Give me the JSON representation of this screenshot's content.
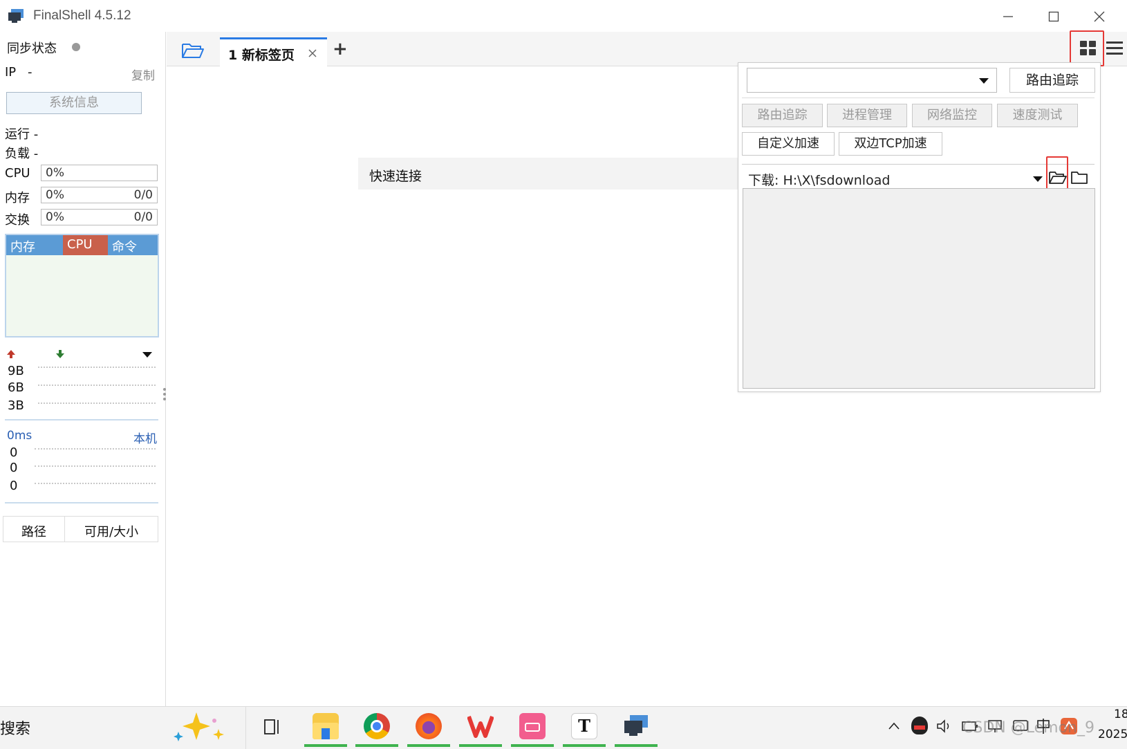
{
  "window": {
    "title": "FinalShell 4.5.12"
  },
  "sidebar": {
    "sync_label": "同步状态",
    "ip_label": "IP",
    "ip_value": "-",
    "copy_label": "复制",
    "sysinfo_button": "系统信息",
    "run_label": "运行 -",
    "load_label": "负载 -",
    "cpu": {
      "label": "CPU",
      "value": "0%"
    },
    "mem": {
      "label": "内存",
      "value": "0%",
      "ratio": "0/0"
    },
    "swap": {
      "label": "交换",
      "value": "0%",
      "ratio": "0/0"
    },
    "tabs": [
      "内存",
      "CPU",
      "命令"
    ],
    "net_ticks": [
      "9B",
      "6B",
      "3B"
    ],
    "ping_label": "0ms",
    "ping_host": "本机",
    "ping_ticks": [
      "0",
      "0",
      "0"
    ],
    "disk_headers": [
      "路径",
      "可用/大小"
    ]
  },
  "tabbar": {
    "tab_label": "1 新标签页",
    "add": "+"
  },
  "quick_connect": "快速连接",
  "panel": {
    "route_button": "路由追踪",
    "tools": [
      "路由追踪",
      "进程管理",
      "网络监控",
      "速度测试"
    ],
    "tools2": [
      "自定义加速",
      "双边TCP加速"
    ],
    "download_label": "下载: H:\\X\\fsdownload"
  },
  "taskbar": {
    "search": "搜索",
    "clock_time": "18",
    "clock_date": "2025",
    "watermark": "CSDN @Lemon_9"
  },
  "colors": {
    "accent": "#2a7be4",
    "mem_tab": "#5b9bd5",
    "cpu_tab": "#c9604b",
    "highlight": "#e53935"
  }
}
